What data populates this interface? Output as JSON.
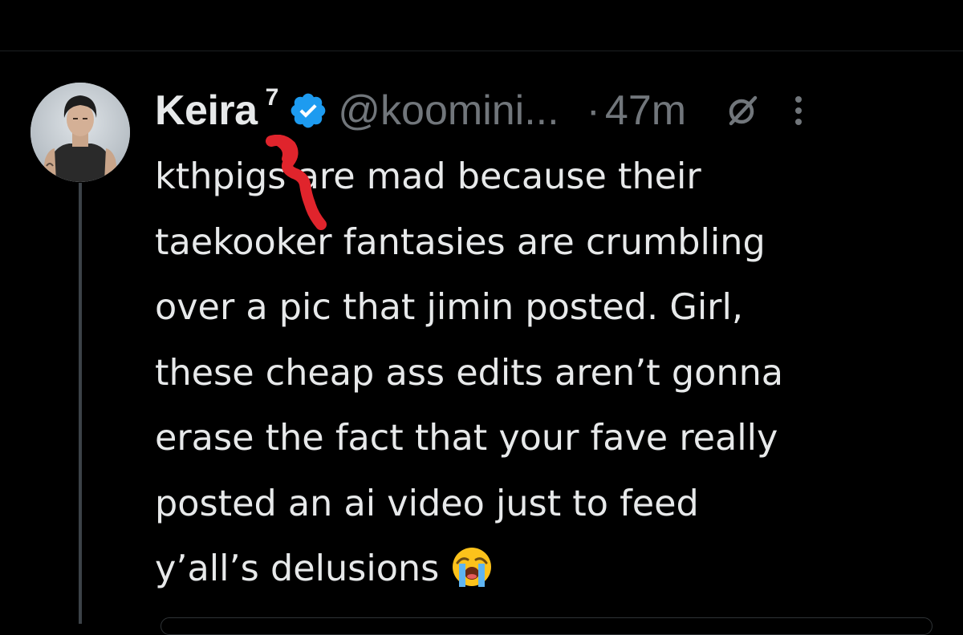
{
  "tweet": {
    "author": {
      "display_name": "Keira",
      "name_superscript": "7",
      "handle": "@koomini...",
      "verified": true
    },
    "separator": "·",
    "timestamp": "47m",
    "text_lines": [
      "kthpigs are mad because their",
      "taekooker fantasies are crumbling",
      "over a pic that jimin posted. Girl,",
      "these cheap ass edits aren’t gonna",
      "erase the fact that your fave really",
      "posted an ai video just to feed",
      "y’all’s delusions"
    ],
    "trailing_emoji": "loudly-crying-face"
  },
  "icons": {
    "verified_badge": "verified-badge-icon",
    "grok": "grok-icon",
    "more": "more-options-icon"
  },
  "colors": {
    "background": "#000000",
    "text_primary": "#e7e9ea",
    "text_secondary": "#71767b",
    "verified_blue": "#1d9bf0",
    "redaction_red": "#e0242c"
  }
}
